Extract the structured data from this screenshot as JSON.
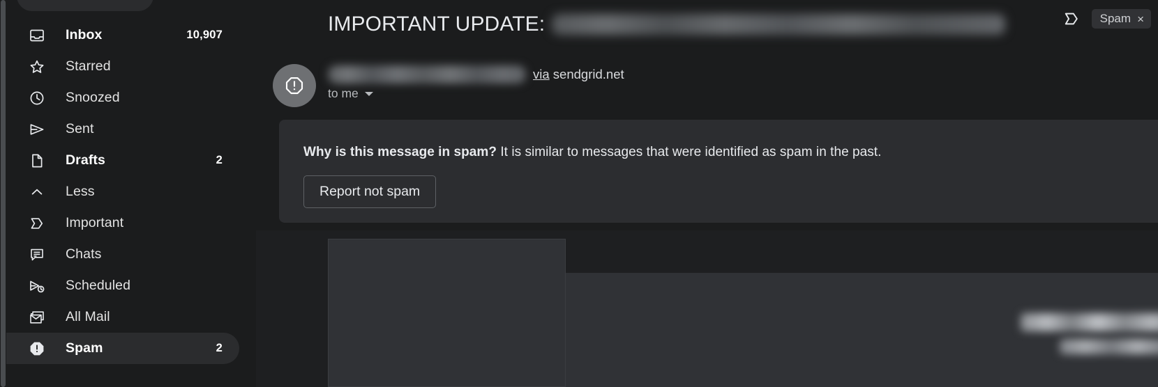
{
  "app": {
    "name": "Gmail",
    "theme": "dark"
  },
  "colors": {
    "background": "#1b1c1d",
    "sidebar_active": "#2b2c2e",
    "banner_background": "#2c2d30",
    "body_panel": "#303236",
    "text_primary": "#e8eaed",
    "text_secondary": "#b7babd",
    "avatar_background": "#6e7073"
  },
  "sidebar": {
    "items": [
      {
        "icon": "inbox-icon",
        "label": "Inbox",
        "count": "10,907",
        "bold": true,
        "active": false
      },
      {
        "icon": "star-icon",
        "label": "Starred",
        "count": "",
        "bold": false,
        "active": false
      },
      {
        "icon": "clock-icon",
        "label": "Snoozed",
        "count": "",
        "bold": false,
        "active": false
      },
      {
        "icon": "send-icon",
        "label": "Sent",
        "count": "",
        "bold": false,
        "active": false
      },
      {
        "icon": "draft-icon",
        "label": "Drafts",
        "count": "2",
        "bold": true,
        "active": false
      },
      {
        "icon": "chevron-up-icon",
        "label": "Less",
        "count": "",
        "bold": false,
        "active": false
      },
      {
        "icon": "important-icon",
        "label": "Important",
        "count": "",
        "bold": false,
        "active": false
      },
      {
        "icon": "chats-icon",
        "label": "Chats",
        "count": "",
        "bold": false,
        "active": false
      },
      {
        "icon": "scheduled-icon",
        "label": "Scheduled",
        "count": "",
        "bold": false,
        "active": false
      },
      {
        "icon": "all-mail-icon",
        "label": "All Mail",
        "count": "",
        "bold": false,
        "active": false
      },
      {
        "icon": "spam-icon",
        "label": "Spam",
        "count": "2",
        "bold": true,
        "active": true
      }
    ]
  },
  "email": {
    "subject_prefix": "IMPORTANT UPDATE:",
    "subject_redacted": true,
    "important_marker": "important-icon",
    "label_chip": {
      "text": "Spam",
      "close": "×"
    },
    "sender": {
      "avatar_icon": "spam-octagon-icon",
      "name_redacted": true,
      "via_label": "via",
      "via_domain": "sendgrid.net",
      "recipient": "to me"
    },
    "spam_banner": {
      "question": "Why is this message in spam?",
      "explanation": "It is similar to messages that were identified as spam in the past.",
      "action_label": "Report not spam"
    },
    "body": {
      "redacted_lines": 2
    }
  }
}
